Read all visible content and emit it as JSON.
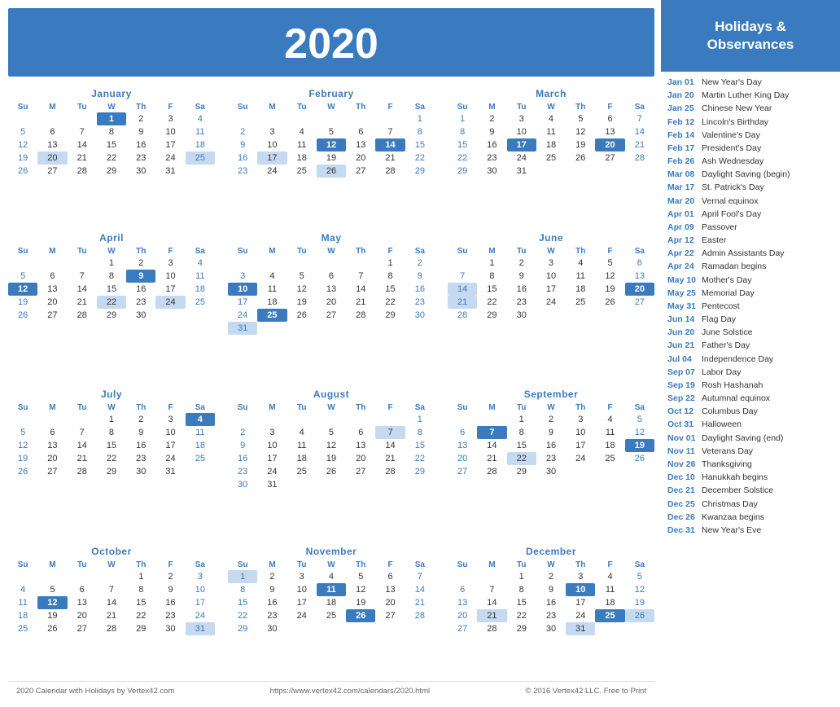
{
  "year": "2020",
  "holidays_header": "Holidays &\nObservances",
  "footer": {
    "left": "2020 Calendar with Holidays by Vertex42.com",
    "center": "https://www.vertex42.com/calendars/2020.html",
    "right": "© 2016 Vertex42 LLC. Free to Print"
  },
  "day_headers": [
    "Su",
    "M",
    "Tu",
    "W",
    "Th",
    "F",
    "Sa"
  ],
  "months": [
    {
      "name": "January",
      "weeks": [
        [
          null,
          null,
          null,
          1,
          2,
          3,
          4
        ],
        [
          5,
          6,
          7,
          8,
          9,
          10,
          11
        ],
        [
          12,
          13,
          14,
          15,
          16,
          17,
          18
        ],
        [
          19,
          20,
          21,
          22,
          23,
          24,
          25
        ],
        [
          26,
          27,
          28,
          29,
          30,
          31,
          null
        ]
      ],
      "highlights": [
        1
      ],
      "light": [
        20,
        25
      ]
    },
    {
      "name": "February",
      "weeks": [
        [
          null,
          null,
          null,
          null,
          null,
          null,
          1
        ],
        [
          2,
          3,
          4,
          5,
          6,
          7,
          8
        ],
        [
          9,
          10,
          11,
          12,
          13,
          14,
          15
        ],
        [
          16,
          17,
          18,
          19,
          20,
          21,
          22
        ],
        [
          23,
          24,
          25,
          26,
          27,
          28,
          29
        ]
      ],
      "highlights": [
        12,
        14
      ],
      "light": [
        17,
        26
      ]
    },
    {
      "name": "March",
      "weeks": [
        [
          1,
          2,
          3,
          4,
          5,
          6,
          7
        ],
        [
          8,
          9,
          10,
          11,
          12,
          13,
          14
        ],
        [
          15,
          16,
          17,
          18,
          19,
          20,
          21
        ],
        [
          22,
          23,
          24,
          25,
          26,
          27,
          28
        ],
        [
          29,
          30,
          31,
          null,
          null,
          null,
          null
        ]
      ],
      "highlights": [
        17,
        20
      ],
      "light": []
    },
    {
      "name": "April",
      "weeks": [
        [
          null,
          null,
          null,
          1,
          2,
          3,
          4
        ],
        [
          5,
          6,
          7,
          8,
          9,
          10,
          11
        ],
        [
          12,
          13,
          14,
          15,
          16,
          17,
          18
        ],
        [
          19,
          20,
          21,
          22,
          23,
          24,
          25
        ],
        [
          26,
          27,
          28,
          29,
          30,
          null,
          null
        ]
      ],
      "highlights": [
        9,
        12
      ],
      "light": [
        22,
        24
      ]
    },
    {
      "name": "May",
      "weeks": [
        [
          null,
          null,
          null,
          null,
          null,
          1,
          2
        ],
        [
          3,
          4,
          5,
          6,
          7,
          8,
          9
        ],
        [
          10,
          11,
          12,
          13,
          14,
          15,
          16
        ],
        [
          17,
          18,
          19,
          20,
          21,
          22,
          23
        ],
        [
          24,
          25,
          26,
          27,
          28,
          29,
          30
        ],
        [
          31,
          null,
          null,
          null,
          null,
          null,
          null
        ]
      ],
      "highlights": [
        10,
        25
      ],
      "light": [
        31
      ]
    },
    {
      "name": "June",
      "weeks": [
        [
          null,
          1,
          2,
          3,
          4,
          5,
          6
        ],
        [
          7,
          8,
          9,
          10,
          11,
          12,
          13
        ],
        [
          14,
          15,
          16,
          17,
          18,
          19,
          20
        ],
        [
          21,
          22,
          23,
          24,
          25,
          26,
          27
        ],
        [
          28,
          29,
          30,
          null,
          null,
          null,
          null
        ]
      ],
      "highlights": [
        20
      ],
      "light": [
        14,
        21
      ]
    },
    {
      "name": "July",
      "weeks": [
        [
          null,
          null,
          null,
          1,
          2,
          3,
          4
        ],
        [
          5,
          6,
          7,
          8,
          9,
          10,
          11
        ],
        [
          12,
          13,
          14,
          15,
          16,
          17,
          18
        ],
        [
          19,
          20,
          21,
          22,
          23,
          24,
          25
        ],
        [
          26,
          27,
          28,
          29,
          30,
          31,
          null
        ]
      ],
      "highlights": [
        4
      ],
      "light": []
    },
    {
      "name": "August",
      "weeks": [
        [
          null,
          null,
          null,
          null,
          null,
          null,
          1
        ],
        [
          2,
          3,
          4,
          5,
          6,
          7,
          8
        ],
        [
          9,
          10,
          11,
          12,
          13,
          14,
          15
        ],
        [
          16,
          17,
          18,
          19,
          20,
          21,
          22
        ],
        [
          23,
          24,
          25,
          26,
          27,
          28,
          29
        ],
        [
          30,
          31,
          null,
          null,
          null,
          null,
          null
        ]
      ],
      "highlights": [],
      "light": [
        7
      ]
    },
    {
      "name": "September",
      "weeks": [
        [
          null,
          null,
          1,
          2,
          3,
          4,
          5
        ],
        [
          6,
          7,
          8,
          9,
          10,
          11,
          12
        ],
        [
          13,
          14,
          15,
          16,
          17,
          18,
          19
        ],
        [
          20,
          21,
          22,
          23,
          24,
          25,
          26
        ],
        [
          27,
          28,
          29,
          30,
          null,
          null,
          null
        ]
      ],
      "highlights": [
        7,
        19
      ],
      "light": [
        22
      ]
    },
    {
      "name": "October",
      "weeks": [
        [
          null,
          null,
          null,
          null,
          1,
          2,
          3
        ],
        [
          4,
          5,
          6,
          7,
          8,
          9,
          10
        ],
        [
          11,
          12,
          13,
          14,
          15,
          16,
          17
        ],
        [
          18,
          19,
          20,
          21,
          22,
          23,
          24
        ],
        [
          25,
          26,
          27,
          28,
          29,
          30,
          31
        ]
      ],
      "highlights": [
        12
      ],
      "light": [
        31
      ]
    },
    {
      "name": "November",
      "weeks": [
        [
          1,
          2,
          3,
          4,
          5,
          6,
          7
        ],
        [
          8,
          9,
          10,
          11,
          12,
          13,
          14
        ],
        [
          15,
          16,
          17,
          18,
          19,
          20,
          21
        ],
        [
          22,
          23,
          24,
          25,
          26,
          27,
          28
        ],
        [
          29,
          30,
          null,
          null,
          null,
          null,
          null
        ]
      ],
      "highlights": [
        11,
        26
      ],
      "light": [
        1
      ]
    },
    {
      "name": "December",
      "weeks": [
        [
          null,
          null,
          1,
          2,
          3,
          4,
          5
        ],
        [
          6,
          7,
          8,
          9,
          10,
          11,
          12
        ],
        [
          13,
          14,
          15,
          16,
          17,
          18,
          19
        ],
        [
          20,
          21,
          22,
          23,
          24,
          25,
          26
        ],
        [
          27,
          28,
          29,
          30,
          31,
          null,
          null
        ]
      ],
      "highlights": [
        10,
        25
      ],
      "light": [
        21,
        26,
        31
      ]
    }
  ],
  "holidays": [
    {
      "date": "Jan 01",
      "name": "New Year's Day"
    },
    {
      "date": "Jan 20",
      "name": "Martin Luther King Day"
    },
    {
      "date": "Jan 25",
      "name": "Chinese New Year"
    },
    {
      "date": "Feb 12",
      "name": "Lincoln's Birthday"
    },
    {
      "date": "Feb 14",
      "name": "Valentine's Day"
    },
    {
      "date": "Feb 17",
      "name": "President's Day"
    },
    {
      "date": "Feb 26",
      "name": "Ash Wednesday"
    },
    {
      "date": "Mar 08",
      "name": "Daylight Saving (begin)"
    },
    {
      "date": "Mar 17",
      "name": "St. Patrick's Day"
    },
    {
      "date": "Mar 20",
      "name": "Vernal equinox"
    },
    {
      "date": "Apr 01",
      "name": "April Fool's Day"
    },
    {
      "date": "Apr 09",
      "name": "Passover"
    },
    {
      "date": "Apr 12",
      "name": "Easter"
    },
    {
      "date": "Apr 22",
      "name": "Admin Assistants Day"
    },
    {
      "date": "Apr 24",
      "name": "Ramadan begins"
    },
    {
      "date": "May 10",
      "name": "Mother's Day"
    },
    {
      "date": "May 25",
      "name": "Memorial Day"
    },
    {
      "date": "May 31",
      "name": "Pentecost"
    },
    {
      "date": "Jun 14",
      "name": "Flag Day"
    },
    {
      "date": "Jun 20",
      "name": "June Solstice"
    },
    {
      "date": "Jun 21",
      "name": "Father's Day"
    },
    {
      "date": "Jul 04",
      "name": "Independence Day"
    },
    {
      "date": "Sep 07",
      "name": "Labor Day"
    },
    {
      "date": "Sep 19",
      "name": "Rosh Hashanah"
    },
    {
      "date": "Sep 22",
      "name": "Autumnal equinox"
    },
    {
      "date": "Oct 12",
      "name": "Columbus Day"
    },
    {
      "date": "Oct 31",
      "name": "Halloween"
    },
    {
      "date": "Nov 01",
      "name": "Daylight Saving (end)"
    },
    {
      "date": "Nov 11",
      "name": "Veterans Day"
    },
    {
      "date": "Nov 26",
      "name": "Thanksgiving"
    },
    {
      "date": "Dec 10",
      "name": "Hanukkah begins"
    },
    {
      "date": "Dec 21",
      "name": "December Solstice"
    },
    {
      "date": "Dec 25",
      "name": "Christmas Day"
    },
    {
      "date": "Dec 26",
      "name": "Kwanzaa begins"
    },
    {
      "date": "Dec 31",
      "name": "New Year's Eve"
    }
  ]
}
